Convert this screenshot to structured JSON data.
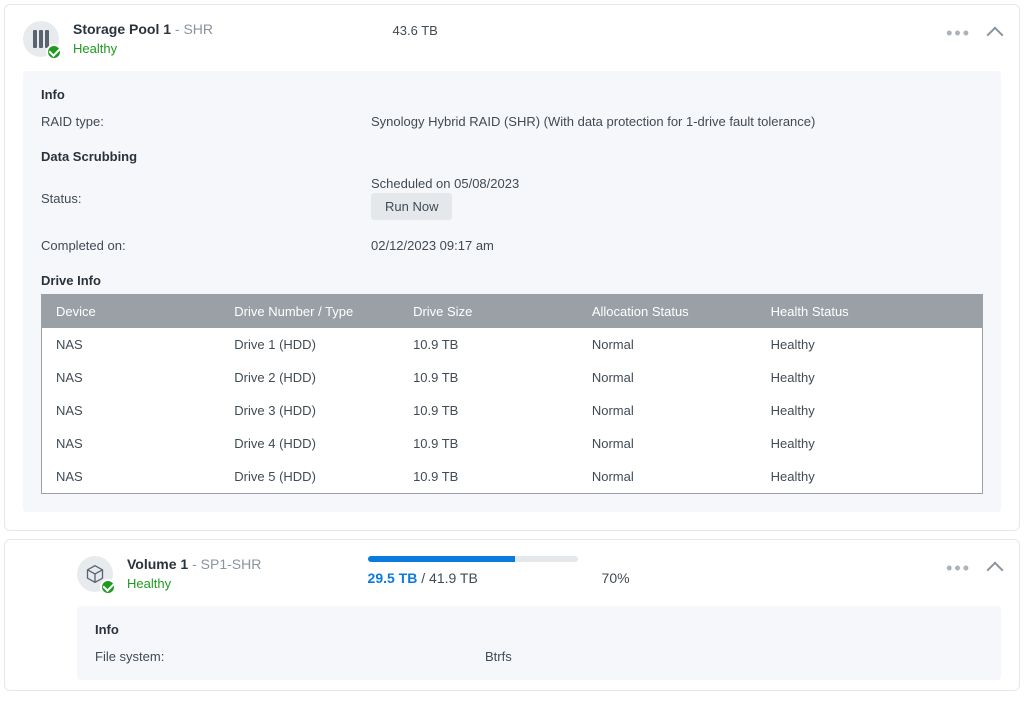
{
  "pool": {
    "title": "Storage Pool 1",
    "suffix": " - SHR",
    "status": "Healthy",
    "capacity": "43.6 TB",
    "info_label": "Info",
    "raid_type_label": "RAID type:",
    "raid_type_value": "Synology Hybrid RAID (SHR) (With data protection for 1-drive fault tolerance)",
    "scrub_label": "Data Scrubbing",
    "scrub_status_label": "Status:",
    "scrub_status_value": "Scheduled on 05/08/2023",
    "run_now": "Run Now",
    "completed_label": "Completed on:",
    "completed_value": "02/12/2023 09:17 am",
    "drive_info_label": "Drive Info",
    "columns": {
      "device": "Device",
      "number": "Drive Number / Type",
      "size": "Drive Size",
      "alloc": "Allocation Status",
      "health": "Health Status"
    },
    "drives": [
      {
        "device": "NAS",
        "num": "Drive 1 (HDD)",
        "size": "10.9 TB",
        "alloc": "Normal",
        "health": "Healthy"
      },
      {
        "device": "NAS",
        "num": "Drive 2 (HDD)",
        "size": "10.9 TB",
        "alloc": "Normal",
        "health": "Healthy"
      },
      {
        "device": "NAS",
        "num": "Drive 3 (HDD)",
        "size": "10.9 TB",
        "alloc": "Normal",
        "health": "Healthy"
      },
      {
        "device": "NAS",
        "num": "Drive 4 (HDD)",
        "size": "10.9 TB",
        "alloc": "Normal",
        "health": "Healthy"
      },
      {
        "device": "NAS",
        "num": "Drive 5 (HDD)",
        "size": "10.9 TB",
        "alloc": "Normal",
        "health": "Healthy"
      }
    ]
  },
  "volume": {
    "title": "Volume 1",
    "suffix": " - SP1-SHR",
    "status": "Healthy",
    "used": "29.5 TB",
    "sep": " / ",
    "total": "41.9 TB",
    "percent_text": "70%",
    "percent_fill": "70%",
    "info_label": "Info",
    "fs_label": "File system:",
    "fs_value": "Btrfs"
  }
}
